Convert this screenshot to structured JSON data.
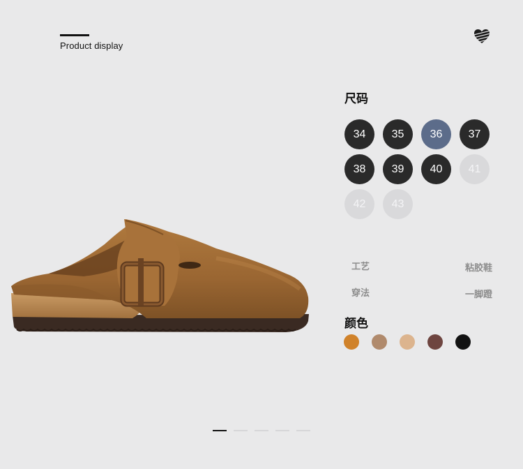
{
  "header": {
    "title": "Product display"
  },
  "size": {
    "title": "尺码",
    "options": [
      {
        "label": "34",
        "state": "available"
      },
      {
        "label": "35",
        "state": "available"
      },
      {
        "label": "36",
        "state": "selected"
      },
      {
        "label": "37",
        "state": "available"
      },
      {
        "label": "38",
        "state": "available"
      },
      {
        "label": "39",
        "state": "available"
      },
      {
        "label": "40",
        "state": "available"
      },
      {
        "label": "41",
        "state": "disabled"
      },
      {
        "label": "42",
        "state": "disabled"
      },
      {
        "label": "43",
        "state": "disabled"
      }
    ]
  },
  "attributes": [
    {
      "label": "工艺",
      "value": "粘胶鞋"
    },
    {
      "label": "穿法",
      "value": "一脚蹬"
    }
  ],
  "colors": {
    "title": "颜色",
    "swatches": [
      "#d0822a",
      "#b08a6c",
      "#dcb48e",
      "#6e4540",
      "#121212"
    ]
  },
  "pager": {
    "count": 5,
    "active": 0
  }
}
